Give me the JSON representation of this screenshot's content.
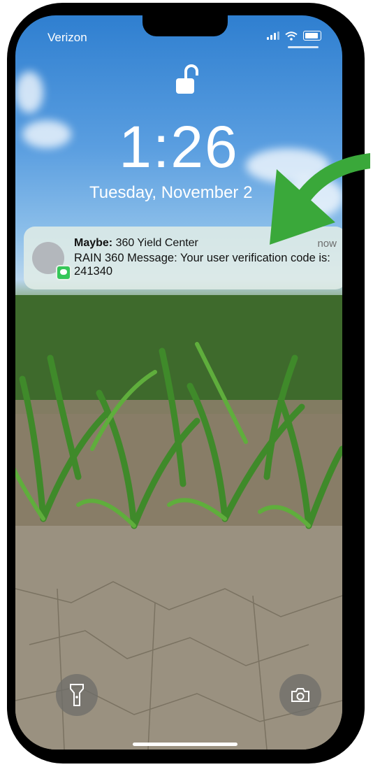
{
  "status_bar": {
    "carrier": "Verizon"
  },
  "lock_screen": {
    "time": "1:26",
    "date": "Tuesday, November 2"
  },
  "notification": {
    "sender_prefix": "Maybe:",
    "sender_name": "360 Yield Center",
    "timestamp": "now",
    "body": "RAIN 360 Message: Your user verification code is: 241340",
    "app_icon": "messages-icon"
  },
  "controls": {
    "left": "flashlight-icon",
    "right": "camera-icon"
  },
  "colors": {
    "arrow": "#3aa83a",
    "notification_bg": "#e1ece6",
    "sky": "#5a9ee0"
  }
}
